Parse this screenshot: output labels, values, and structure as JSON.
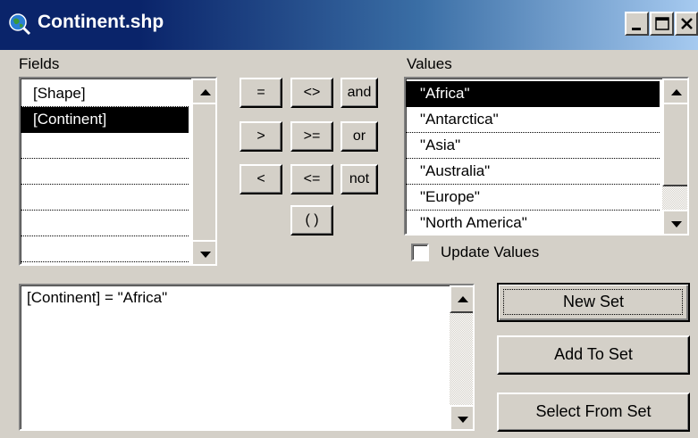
{
  "window": {
    "title": "Continent.shp",
    "controls": [
      "minimize-icon",
      "maximize-icon",
      "close-icon"
    ]
  },
  "fields": {
    "label": "Fields",
    "items": [
      "[Shape]",
      "[Continent]",
      "",
      "",
      "",
      "",
      ""
    ],
    "selected_index": 1
  },
  "operators": {
    "eq": "=",
    "neq": "<>",
    "and": "and",
    "gt": ">",
    "gte": ">=",
    "or": "or",
    "lt": "<",
    "lte": "<=",
    "not": "not",
    "paren": "( )"
  },
  "values": {
    "label": "Values",
    "items": [
      "\"Africa\"",
      "\"Antarctica\"",
      "\"Asia\"",
      "\"Australia\"",
      "\"Europe\"",
      "\"North America\""
    ],
    "selected_index": 0
  },
  "update_values": {
    "label": "Update Values",
    "checked": false
  },
  "expression": {
    "text": "[Continent] = \"Africa\""
  },
  "buttons": {
    "new_set": "New Set",
    "add_to_set": "Add To Set",
    "select_from_set": "Select From Set"
  },
  "colors": {
    "title_start": "#0a246a",
    "title_end": "#a6caf0",
    "face": "#d4d0c8",
    "selection": "#000000"
  }
}
